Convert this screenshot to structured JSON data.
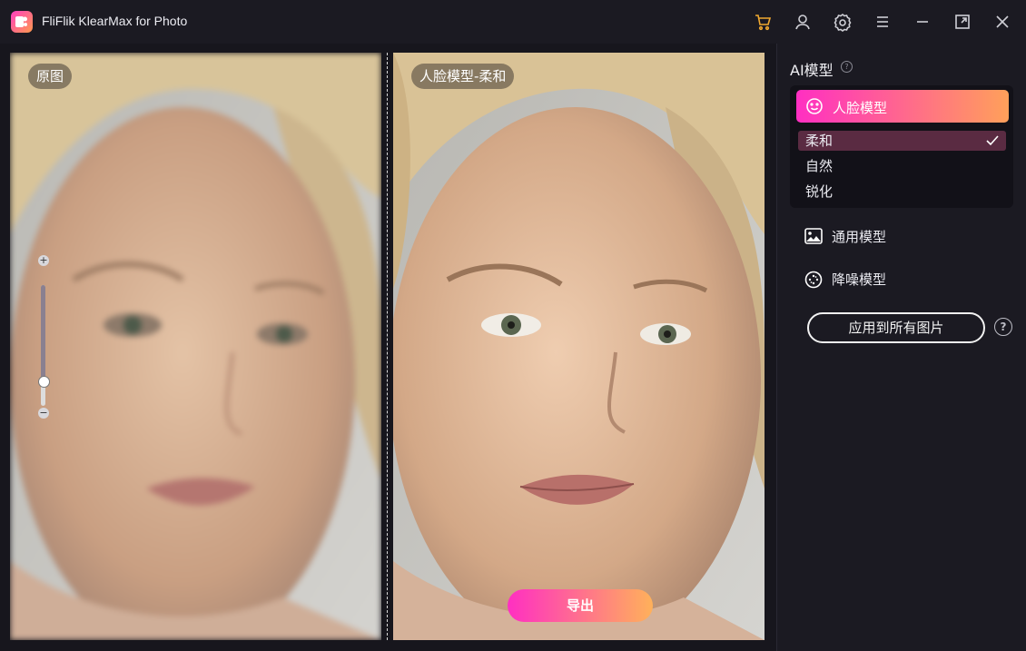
{
  "app": {
    "title": "FliFlik KlearMax for Photo"
  },
  "titlebar": {
    "icons": [
      "cart-icon",
      "user-icon",
      "gear-icon",
      "menu-icon",
      "minimize-icon",
      "maximize-icon",
      "close-icon"
    ]
  },
  "viewer": {
    "left_label": "原图",
    "right_label": "人脸模型-柔和",
    "zoom_level": 0.2,
    "zoom_plus": "+",
    "zoom_minus": "−",
    "export_label": "导出"
  },
  "panel": {
    "title": "AI模型",
    "help_glyph": "?",
    "active_model": "人脸模型",
    "sub_options": [
      {
        "label": "柔和",
        "selected": true
      },
      {
        "label": "自然",
        "selected": false
      },
      {
        "label": "锐化",
        "selected": false
      }
    ],
    "models": [
      {
        "label": "通用模型",
        "icon": "image-icon"
      },
      {
        "label": "降噪模型",
        "icon": "denoise-icon"
      }
    ],
    "apply_all_label": "应用到所有图片",
    "apply_help_glyph": "?"
  },
  "colors": {
    "accent_gradient_start": "#ff2fc2",
    "accent_gradient_end": "#ffa05a",
    "cart_icon": "#f0a830",
    "background": "#1b1a22"
  }
}
